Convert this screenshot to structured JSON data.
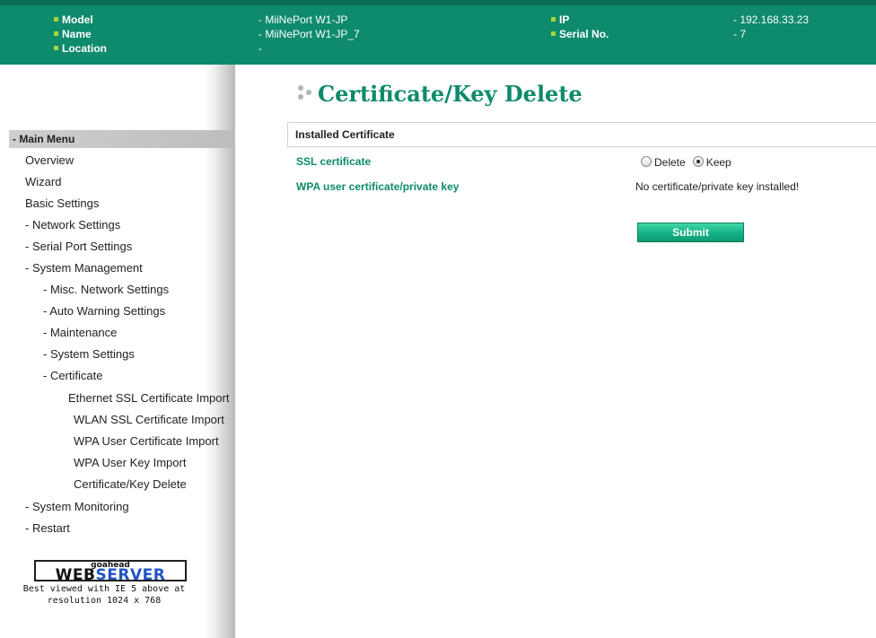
{
  "header": {
    "model_label": "Model",
    "model_value": "- MiiNePort W1-JP",
    "name_label": "Name",
    "name_value": "- MiiNePort W1-JP_7",
    "location_label": "Location",
    "location_value": "-",
    "ip_label": "IP",
    "ip_value": "- 192.168.33.23",
    "serial_label": "Serial No.",
    "serial_value": "- 7"
  },
  "sidebar": {
    "menu_title": "- Main Menu",
    "items": [
      "Overview",
      "Wizard",
      "Basic Settings",
      "- Network Settings",
      "- Serial Port Settings",
      "- System Management",
      "- Misc. Network Settings",
      "- Auto Warning Settings",
      "- Maintenance",
      "- System Settings",
      "- Certificate",
      "Ethernet SSL Certificate Import",
      "WLAN SSL Certificate Import",
      "WPA User Certificate Import",
      "WPA User Key Import",
      "Certificate/Key Delete",
      "- System Monitoring",
      "- Restart"
    ],
    "logo_small": "goahead",
    "logo_web": "WEB",
    "logo_server": "SERVER",
    "best_viewed_line1": "Best viewed with IE 5 above at",
    "best_viewed_line2": "resolution 1024 x 768"
  },
  "main": {
    "title": "Certificate/Key Delete",
    "section_title": "Installed Certificate",
    "ssl_label": "SSL certificate",
    "ssl_delete_label": "Delete",
    "ssl_keep_label": "Keep",
    "ssl_selected": "Keep",
    "wpa_label": "WPA user certificate/private key",
    "wpa_value": "No certificate/private key installed!",
    "submit_label": "Submit"
  },
  "colors": {
    "brand_green": "#0e8a6c",
    "bullet_lime": "#a5d63b",
    "submit_green": "#17b489"
  }
}
